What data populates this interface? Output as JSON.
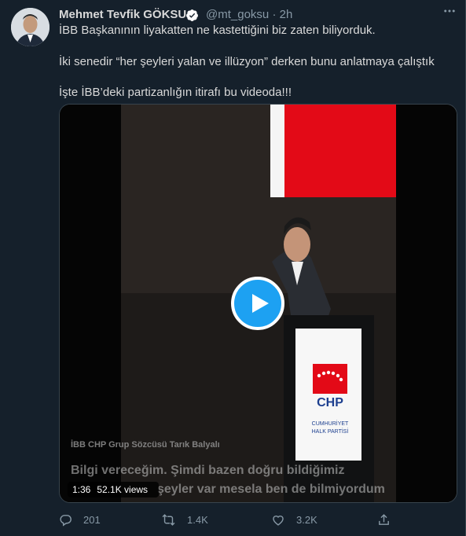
{
  "tweet": {
    "author_name": "Mehmet Tevfik GÖKSU",
    "handle": "@mt_goksu",
    "separator": "·",
    "time": "2h",
    "lines": [
      "İBB Başkanının liyakatten ne kastettiğini biz zaten biliyorduk.",
      "İki senedir “her şeyleri yalan ve illüzyon” derken bunu anlatmaya çalıştık",
      "İşte İBB’deki partizanlığın itirafı bu videoda!!!"
    ]
  },
  "video": {
    "duration": "1:36",
    "views": "52.1K views",
    "caption_name": "İBB CHP Grup Sözcüsü Tarık Balyalı",
    "subtitle_line1": "Bilgi vereceğim. Şimdi bazen doğru bildiğimiz",
    "subtitle_line2": "şeyler var mesela ben de bilmiyordum",
    "podium_logo": "CHP",
    "podium_line1": "CUMHURİYET",
    "podium_line2": "HALK PARTİSİ"
  },
  "actions": {
    "reply_count": "201",
    "retweet_count": "1.4K",
    "like_count": "3.2K"
  },
  "icons": {
    "verified": "verified-badge-icon",
    "more": "more-icon",
    "reply": "reply-icon",
    "retweet": "retweet-icon",
    "like": "like-icon",
    "share": "share-icon",
    "play": "play-icon"
  },
  "colors": {
    "background": "#15202b",
    "accent": "#1da1f2",
    "chp_red": "#e30a17"
  }
}
